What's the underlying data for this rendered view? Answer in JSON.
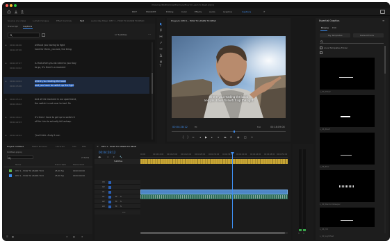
{
  "title": "/Volumes/RAID/Adobe/Premiere/How to Learn to Read.prproj",
  "workspaces": [
    "EDIT",
    "FAVORITE",
    "Editing",
    "Color",
    "Effects",
    "Audio",
    "Graphics",
    "Captions"
  ],
  "active_workspace": "Captions",
  "source_tabs": [
    "Source: (no clips)",
    "Lumetri Scopes",
    "Effect Controls",
    "Text",
    "Audio Clip Mixer: DEV 1 - HOW TO LEARN TO READ"
  ],
  "text_subtabs": [
    "Transcript",
    "Captions"
  ],
  "search_placeholder": "",
  "caption_count": "17 Subtitles",
  "captions": [
    {
      "tc1": "00:04:04:06",
      "tc2": "00:04:07:06",
      "text": [
        "without you having to fight",
        "hard for them, you see, the thing"
      ]
    },
    {
      "tc1": "00:04:07:07",
      "tc2": "00:04:10:02",
      "text": [
        "is that when you do need to your boy",
        "to go, it's there's a moment"
      ]
    },
    {
      "tc1": "00:04:10:04",
      "tc2": "00:04:15:06",
      "text": [
        "where you reading the book",
        "and you have to switch up the light"
      ]
    },
    {
      "tc1": "00:04:15:14",
      "tc2": "00:04:18:22",
      "text": [
        "And at the moment in our apartment,",
        "the switch is not near to bed. So"
      ]
    },
    {
      "tc1": "00:04:18:22",
      "tc2": "00:04:22:03",
      "text": [
        "it's then I have to get up to switch it",
        "off for him to actually fall asleep."
      ]
    },
    {
      "tc1": "00:04:22:04",
      "tc2": "",
      "text": [
        "\"Just think. Andy it can",
        ""
      ]
    }
  ],
  "program_title": "Program: DEV 1 - HOW TO LEARN TO READ",
  "subtitle_lines": [
    "where you reading the book",
    "and you have to switch up the light"
  ],
  "program_tc": "00:04:28:12",
  "fit": "Fit",
  "quality": "Full",
  "duration": "00:18:09:08",
  "project_tabs": [
    "Project: Untitled",
    "Media Browser",
    "Libraries",
    "Info",
    "Effe"
  ],
  "project_file": "Untitled.prproj",
  "items_count": "2 items",
  "project_cols": [
    "Name",
    "Frame Rate",
    "Media Start"
  ],
  "project_items": [
    {
      "name": "DEV 1 - HOW TO LEARN TO R",
      "fps": "25.00 fps",
      "start": "00:00:00:00",
      "color": "#5fb04a"
    },
    {
      "name": "DEV 1 - HOW TO LEARN TO R",
      "fps": "25.00 fps",
      "start": "00:00:00:00",
      "color": "#3e8ef0"
    }
  ],
  "timeline_tab": "DEV 1 - HOW TO LEARN TO READ",
  "timeline_tc": "00:04:28:12",
  "subtitles_row": "Subtitles",
  "ruler": [
    "00:00",
    "00:04:16:00",
    "00:04:20:00",
    "00:04:24:00",
    "00:04:28:00",
    "00:04:32:00",
    "00:04:36:00",
    "00:04:40:00",
    "00:04:44:00",
    "00:04:48:00",
    "00:04:52:00"
  ],
  "video_tracks": [
    "V3",
    "V2",
    "V1"
  ],
  "audio_tracks": [
    "A1",
    "A2",
    "A3"
  ],
  "essential_title": "Essential Graphics",
  "eg_tabs": [
    "Browse",
    "Edit"
  ],
  "eg_dropdowns": [
    "My Templates",
    "Default Fonts"
  ],
  "eg_check": "Local Templates Folder",
  "eg_templates": [
    "L_03_Title2",
    "L_06_Blur3",
    "L_06_Blur",
    "L_09_RandomDeeper",
    "L_06_3D",
    "L_09_Lightfast"
  ]
}
